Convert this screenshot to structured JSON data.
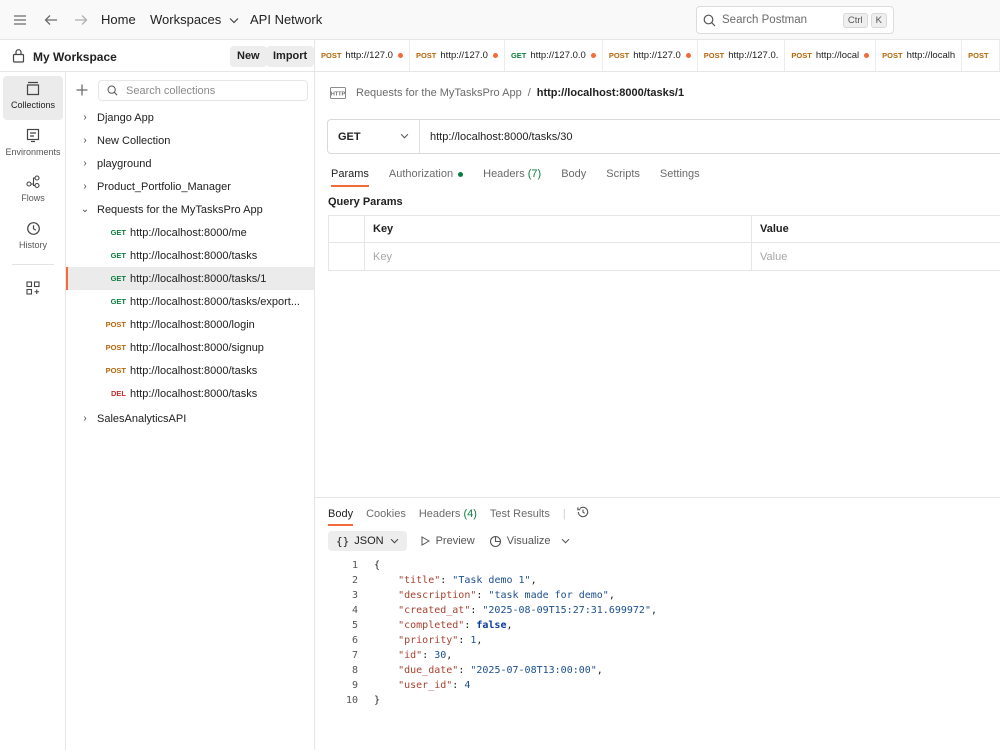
{
  "topbar": {
    "home": "Home",
    "workspaces": "Workspaces",
    "api_network": "API Network",
    "search_placeholder": "Search Postman",
    "shortcut_ctrl": "Ctrl",
    "shortcut_k": "K"
  },
  "workspace": {
    "title": "My Workspace",
    "new_label": "New",
    "import_label": "Import"
  },
  "tabs": [
    {
      "method": "POST",
      "label": "http://127.0",
      "dot": true
    },
    {
      "method": "POST",
      "label": "http://127.0",
      "dot": true
    },
    {
      "method": "GET",
      "label": "http://127.0.0",
      "dot": true
    },
    {
      "method": "POST",
      "label": "http://127.0",
      "dot": true
    },
    {
      "method": "POST",
      "label": "http://127.0.",
      "dot": false
    },
    {
      "method": "POST",
      "label": "http://local",
      "dot": true
    },
    {
      "method": "POST",
      "label": "http://localh",
      "dot": false
    },
    {
      "method": "POST",
      "label": "",
      "dot": false
    }
  ],
  "rail": {
    "collections": "Collections",
    "environments": "Environments",
    "flows": "Flows",
    "history": "History"
  },
  "collections": {
    "search_placeholder": "Search collections",
    "items": [
      {
        "label": "Django App"
      },
      {
        "label": "New Collection"
      },
      {
        "label": "playground"
      },
      {
        "label": "Product_Portfolio_Manager"
      },
      {
        "label": "Requests for the MyTasksPro App"
      },
      {
        "label": "SalesAnalyticsAPI"
      }
    ],
    "requests": [
      {
        "method": "GET",
        "label": "http://localhost:8000/me"
      },
      {
        "method": "GET",
        "label": "http://localhost:8000/tasks"
      },
      {
        "method": "GET",
        "label": "http://localhost:8000/tasks/1"
      },
      {
        "method": "GET",
        "label": "http://localhost:8000/tasks/export..."
      },
      {
        "method": "POST",
        "label": "http://localhost:8000/login"
      },
      {
        "method": "POST",
        "label": "http://localhost:8000/signup"
      },
      {
        "method": "POST",
        "label": "http://localhost:8000/tasks"
      },
      {
        "method": "DEL",
        "label": "http://localhost:8000/tasks"
      }
    ]
  },
  "request": {
    "breadcrumb_parent": "Requests for the MyTasksPro App",
    "breadcrumb_sep": "/",
    "breadcrumb_current": "http://localhost:8000/tasks/1",
    "method": "GET",
    "url": "http://localhost:8000/tasks/30",
    "tabs": {
      "params": "Params",
      "authorization": "Authorization",
      "headers": "Headers",
      "headers_count": "(7)",
      "body": "Body",
      "scripts": "Scripts",
      "settings": "Settings"
    },
    "query_params_title": "Query Params",
    "col_key": "Key",
    "col_value": "Value",
    "key_placeholder": "Key",
    "value_placeholder": "Value"
  },
  "response": {
    "tabs": {
      "body": "Body",
      "cookies": "Cookies",
      "headers": "Headers",
      "headers_count": "(4)",
      "test_results": "Test Results"
    },
    "format": "JSON",
    "format_icon": "{}",
    "preview": "Preview",
    "visualize": "Visualize",
    "lines": [
      {
        "n": "1",
        "text": "{"
      },
      {
        "n": "2",
        "key": "\"title\"",
        "val": "\"Task demo 1\"",
        "type": "s"
      },
      {
        "n": "3",
        "key": "\"description\"",
        "val": "\"task made for demo\"",
        "type": "s"
      },
      {
        "n": "4",
        "key": "\"created_at\"",
        "val": "\"2025-08-09T15:27:31.699972\"",
        "type": "s"
      },
      {
        "n": "5",
        "key": "\"completed\"",
        "val": "false",
        "type": "b"
      },
      {
        "n": "6",
        "key": "\"priority\"",
        "val": "1",
        "type": "n"
      },
      {
        "n": "7",
        "key": "\"id\"",
        "val": "30",
        "type": "n"
      },
      {
        "n": "8",
        "key": "\"due_date\"",
        "val": "\"2025-07-08T13:00:00\"",
        "type": "s"
      },
      {
        "n": "9",
        "key": "\"user_id\"",
        "val": "4",
        "type": "n",
        "last": true
      },
      {
        "n": "10",
        "text": "}"
      }
    ]
  },
  "colors": {
    "accent": "#f26b3a",
    "get": "#0d7c3f",
    "post": "#b5670a",
    "delete": "#c4302b"
  }
}
